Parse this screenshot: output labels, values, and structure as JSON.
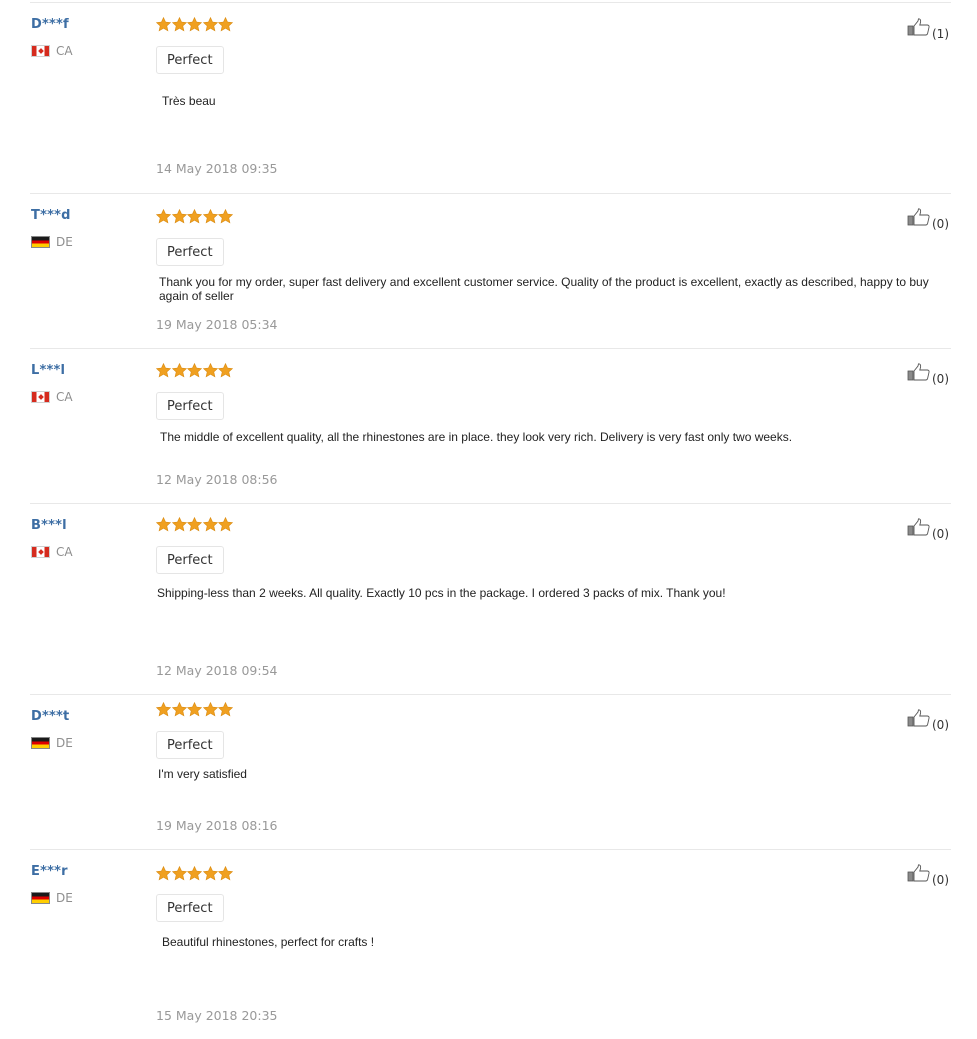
{
  "reviews": [
    {
      "buyer": "D***f",
      "country": "CA",
      "flag": "ca",
      "rating": 5,
      "label": "Perfect",
      "text": "Très beau",
      "date": "14 May 2018 09:35",
      "likes": "(1)"
    },
    {
      "buyer": "T***d",
      "country": "DE",
      "flag": "de",
      "rating": 5,
      "label": "Perfect",
      "text": "Thank you for my order, super fast delivery and excellent customer service. Quality of the product is excellent, exactly as described, happy to buy again of seller",
      "date": "19 May 2018 05:34",
      "likes": "(0)"
    },
    {
      "buyer": "L***l",
      "country": "CA",
      "flag": "ca",
      "rating": 5,
      "label": "Perfect",
      "text": "The middle of excellent quality, all the rhinestones are in place. they look very rich. Delivery is very fast only two weeks.",
      "date": "12 May 2018 08:56",
      "likes": "(0)"
    },
    {
      "buyer": "B***l",
      "country": "CA",
      "flag": "ca",
      "rating": 5,
      "label": "Perfect",
      "text": "Shipping-less than 2 weeks. All quality. Exactly 10 pcs in the package. I ordered 3 packs of mix. Thank you!",
      "date": "12 May 2018 09:54",
      "likes": "(0)"
    },
    {
      "buyer": "D***t",
      "country": "DE",
      "flag": "de",
      "rating": 5,
      "label": "Perfect",
      "text": "I'm very satisfied",
      "date": "19 May 2018 08:16",
      "likes": "(0)"
    },
    {
      "buyer": "E***r",
      "country": "DE",
      "flag": "de",
      "rating": 5,
      "label": "Perfect",
      "text": "Beautiful rhinestones, perfect for crafts !",
      "date": "15 May 2018 20:35",
      "likes": "(0)"
    }
  ],
  "colors": {
    "star": "#f0a020",
    "buyer": "#3d6ea4",
    "date": "#999999"
  },
  "icons": {
    "rating": "star-icon",
    "helpful": "thumbs-up-icon"
  }
}
